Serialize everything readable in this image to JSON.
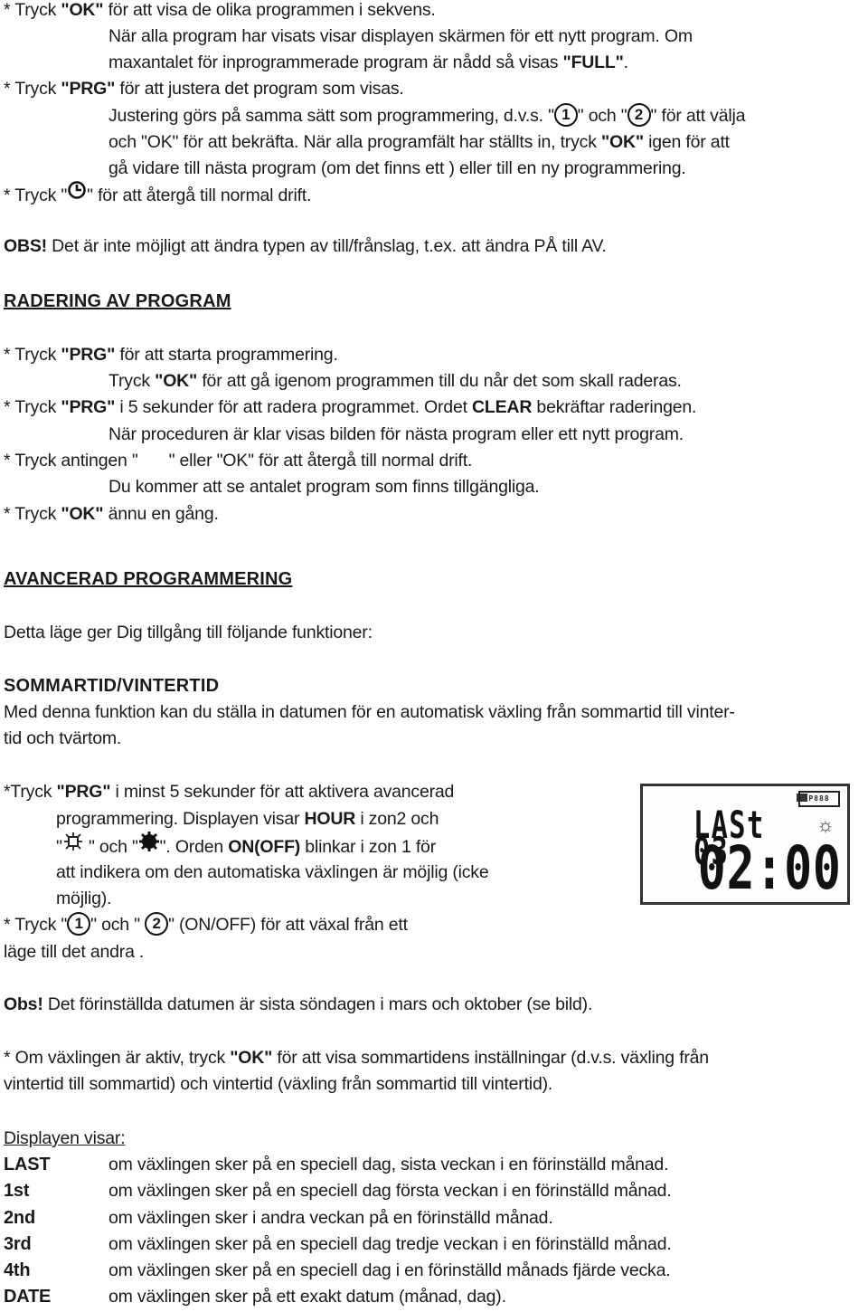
{
  "section1": {
    "l1": {
      "pre": "* Tryck ",
      "key": "\"OK\"",
      "post": " för att visa de olika programmen i sekvens."
    },
    "l2": "När alla program har visats visar displayen skärmen för ett nytt program. Om",
    "l3": {
      "pre": "maxantalet för inprogrammerade program är nådd så visas ",
      "key": "\"FULL\"",
      "post": "."
    },
    "l4": {
      "pre": "* Tryck ",
      "key": "\"PRG\"",
      "post": " för att justera det program som visas."
    },
    "l5": {
      "pre": "Justering görs på samma sätt som programmering, d.v.s. \"",
      "btn1": "1",
      "mid": "\" och \"",
      "btn2": "2",
      "post": "\" för att välja"
    },
    "l6": {
      "pre": "och \"OK\" för att bekräfta. När alla programfält har ställts in, tryck ",
      "key": "\"OK\"",
      "post": "  igen för att"
    },
    "l7": "gå vidare till nästa program (om det finns ett ) eller till en ny programmering.",
    "l8": {
      "pre": "* Tryck \"",
      "post": "\" för att återgå till normal drift."
    }
  },
  "obs1": {
    "label": "OBS!",
    "text": " Det är inte möjligt att ändra typen av till/frånslag, t.ex. att ändra PÅ till AV."
  },
  "radering": {
    "heading": "RADERING AV PROGRAM",
    "l1": {
      "pre": "* Tryck ",
      "key": "\"PRG\"",
      "post": " för att starta programmering."
    },
    "l2": {
      "pre": "Tryck ",
      "key": "\"OK\"",
      "post": " för att gå igenom programmen till du når det som skall raderas."
    },
    "l3": {
      "pre": "* Tryck ",
      "key": "\"PRG\"",
      "mid": " i 5 sekunder för att radera programmet. Ordet ",
      "word": "CLEAR",
      "post": " bekräftar raderingen."
    },
    "l4": "När proceduren är klar visas bilden för nästa program eller ett nytt program.",
    "l5": {
      "pre": "* Tryck antingen \"",
      "post": "\" eller \"OK\" för att återgå till normal drift."
    },
    "l6": "Du kommer att se antalet program som finns tillgängliga.",
    "l7": {
      "pre": "* Tryck ",
      "key": "\"OK\"",
      "post": " ännu en gång."
    }
  },
  "avancerad": {
    "heading": "AVANCERAD PROGRAMMERING",
    "intro": "Detta läge ger Dig tillgång till följande funktioner:",
    "subheading": "SOMMARTID/VINTERTID",
    "desc1": "Med denna funktion kan du ställa in datumen för en automatisk växling från sommartid till vinter-",
    "desc2": "tid och tvärtom.",
    "p1": {
      "pre": "*Tryck ",
      "key": "\"PRG\"",
      "post": " i minst 5 sekunder för att aktivera avancerad"
    },
    "p2": {
      "pre": "programmering. Displayen visar ",
      "key": "HOUR",
      "post": " i zon2 och"
    },
    "p3": {
      "pre": "\"",
      "mid": " \" och \"",
      "mid2": "\". Orden ",
      "key": "ON(OFF)",
      "post": " blinkar i zon 1 för"
    },
    "p4": "att indikera om den automatiska växlingen är möjlig (icke",
    "p5": "möjlig).",
    "p6": {
      "pre": "* Tryck \"",
      "btn1": "1",
      "mid": "\" och \" ",
      "btn2": "2",
      "post": "\" (ON/OFF) för att växal från ett"
    },
    "p7": "läge till det andra ."
  },
  "lcd": {
    "line1": "LASt 03",
    "time": "02:00",
    "box_label": "P888"
  },
  "obs2": {
    "label": "Obs!",
    "text": " Det förinställda datumen är sista söndagen i mars och oktober (se bild)."
  },
  "active": {
    "l1": {
      "pre": "* Om växlingen är aktiv, tryck ",
      "key": "\"OK\"",
      "post": " för att visa sommartidens inställningar (d.v.s. växling från"
    },
    "l2": "vintertid till sommartid) och vintertid (växling från sommartid till vintertid)."
  },
  "display_list": {
    "title": "Displayen visar:",
    "items": [
      {
        "term": "LAST",
        "desc": "om växlingen sker på en speciell dag, sista veckan i en förinställd månad."
      },
      {
        "term": "1st",
        "desc": "om växlingen sker på en speciell dag första veckan i en förinställd månad."
      },
      {
        "term": "2nd",
        "desc": "om växlingen sker i andra veckan på en förinställd månad."
      },
      {
        "term": "3rd",
        "desc": "om växlingen sker på en speciell dag tredje veckan i en förinställd månad."
      },
      {
        "term": "4th",
        "desc": "om växlingen sker på en speciell dag i en förinställd månads fjärde vecka."
      },
      {
        "term": "DATE",
        "desc": "om växlingen sker på ett exakt datum (månad, dag)."
      }
    ]
  }
}
